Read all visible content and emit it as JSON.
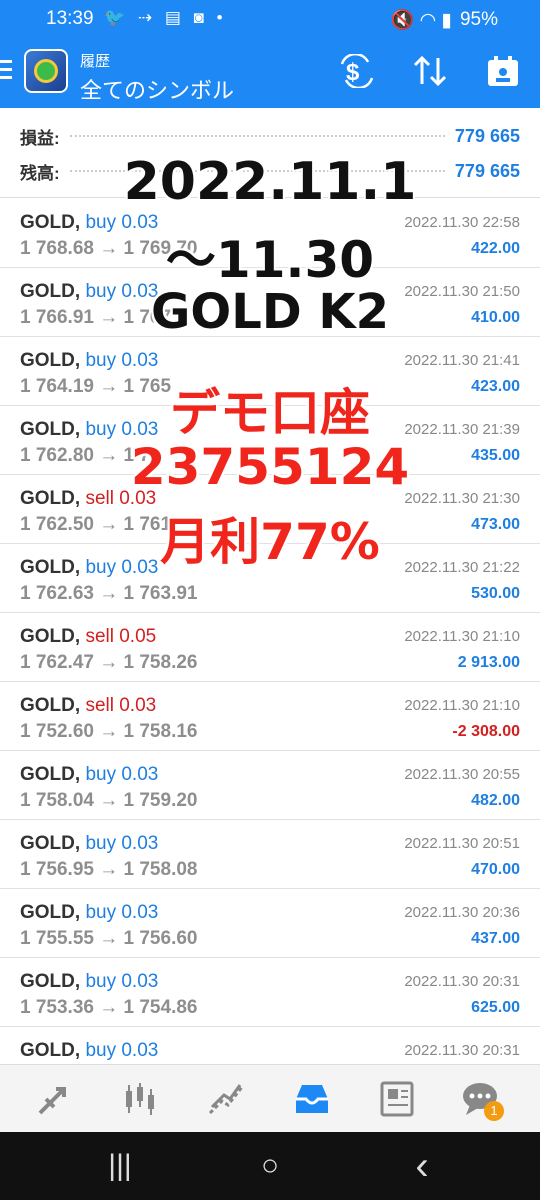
{
  "status": {
    "time": "13:39",
    "left_icons": "🐦 ⇢ ▤ ◙ •",
    "battery": "95%",
    "right_icons": "🔇 ◠ ▮"
  },
  "appbar": {
    "subtitle": "履歴",
    "title": "全てのシンボル",
    "logo_icon": "metatrader-logo-icon",
    "icons": [
      "menu-icon",
      "currency-swap-icon",
      "sort-icon",
      "calendar-icon"
    ]
  },
  "summary": {
    "profit_label": "損益:",
    "profit_value": "779 665",
    "balance_label": "残高:",
    "balance_value": "779 665"
  },
  "deals": [
    {
      "symbol": "GOLD,",
      "side": "buy",
      "side_label": "buy 0.03",
      "price": "1 768.68 → 1 769.70",
      "time": "2022.11.30 22:58",
      "profit": "422.00"
    },
    {
      "symbol": "GOLD,",
      "side": "buy",
      "side_label": "buy 0.03",
      "price": "1 766.91 → 1 767",
      "time": "2022.11.30 21:50",
      "profit": "410.00"
    },
    {
      "symbol": "GOLD,",
      "side": "buy",
      "side_label": "buy 0.03",
      "price": "1 764.19 → 1 765",
      "time": "2022.11.30 21:41",
      "profit": "423.00"
    },
    {
      "symbol": "GOLD,",
      "side": "buy",
      "side_label": "buy 0.03",
      "price": "1 762.80 → 1 7",
      "time": "2022.11.30 21:39",
      "profit": "435.00"
    },
    {
      "symbol": "GOLD,",
      "side": "sell",
      "side_label": "sell 0.03",
      "price": "1 762.50 → 1 761",
      "time": "2022.11.30 21:30",
      "profit": "473.00"
    },
    {
      "symbol": "GOLD,",
      "side": "buy",
      "side_label": "buy 0.03",
      "price": "1 762.63 → 1 763.91",
      "time": "2022.11.30 21:22",
      "profit": "530.00"
    },
    {
      "symbol": "GOLD,",
      "side": "sell",
      "side_label": "sell 0.05",
      "price": "1 762.47 → 1 758.26",
      "time": "2022.11.30 21:10",
      "profit": "2 913.00"
    },
    {
      "symbol": "GOLD,",
      "side": "sell",
      "side_label": "sell 0.03",
      "price": "1 752.60 → 1 758.16",
      "time": "2022.11.30 21:10",
      "profit": "-2 308.00"
    },
    {
      "symbol": "GOLD,",
      "side": "buy",
      "side_label": "buy 0.03",
      "price": "1 758.04 → 1 759.20",
      "time": "2022.11.30 20:55",
      "profit": "482.00"
    },
    {
      "symbol": "GOLD,",
      "side": "buy",
      "side_label": "buy 0.03",
      "price": "1 756.95 → 1 758.08",
      "time": "2022.11.30 20:51",
      "profit": "470.00"
    },
    {
      "symbol": "GOLD,",
      "side": "buy",
      "side_label": "buy 0.03",
      "price": "1 755.55 → 1 756.60",
      "time": "2022.11.30 20:36",
      "profit": "437.00"
    },
    {
      "symbol": "GOLD,",
      "side": "buy",
      "side_label": "buy 0.03",
      "price": "1 753.36 → 1 754.86",
      "time": "2022.11.30 20:31",
      "profit": "625.00"
    },
    {
      "symbol": "GOLD,",
      "side": "buy",
      "side_label": "buy 0.03",
      "price": "",
      "time": "2022.11.30 20:31",
      "profit": ""
    }
  ],
  "overlay": {
    "line1": "2022.11.1",
    "line2": "〜11.30",
    "line3": "GOLD K2",
    "line4": "デモ口座",
    "line5": "23755124",
    "line6": "月利77%"
  },
  "tabbar": {
    "icons": [
      "quotes-icon",
      "chart-icon",
      "trade-icon",
      "history-icon",
      "news-icon",
      "messages-icon"
    ],
    "badge": "1"
  },
  "navbar": {
    "recent": "|||",
    "home": "○",
    "back": "‹"
  }
}
